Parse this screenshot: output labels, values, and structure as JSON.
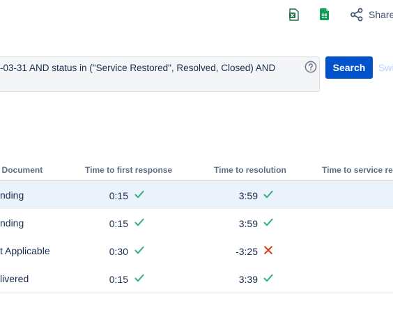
{
  "toolbar": {
    "excel_icon": "excel-icon",
    "sheets_icon": "google-sheets-icon",
    "share_label": "Share"
  },
  "search": {
    "jql": "-03-31 AND status in (\"Service Restored\", Resolved, Closed) AND",
    "button_label": "Search",
    "switch_label": "Switch"
  },
  "table": {
    "headers": [
      "A Document",
      "Time to first response",
      "Time to resolution",
      "Time to service re"
    ],
    "rows": [
      {
        "doc": "nding",
        "first": "0:15",
        "first_status": "met",
        "resolution": "3:59",
        "resolution_status": "met",
        "highlighted": true
      },
      {
        "doc": "nding",
        "first": "0:15",
        "first_status": "met",
        "resolution": "3:59",
        "resolution_status": "met",
        "highlighted": false
      },
      {
        "doc": "t Applicable",
        "first": "0:30",
        "first_status": "met",
        "resolution": "-3:25",
        "resolution_status": "breached",
        "highlighted": false
      },
      {
        "doc": "livered",
        "first": "0:15",
        "first_status": "met",
        "resolution": "3:39",
        "resolution_status": "met",
        "highlighted": false
      }
    ]
  },
  "colors": {
    "primary": "#0052cc",
    "met": "#36b37e",
    "breached": "#de350b",
    "highlight_row": "#ebf2fc"
  }
}
